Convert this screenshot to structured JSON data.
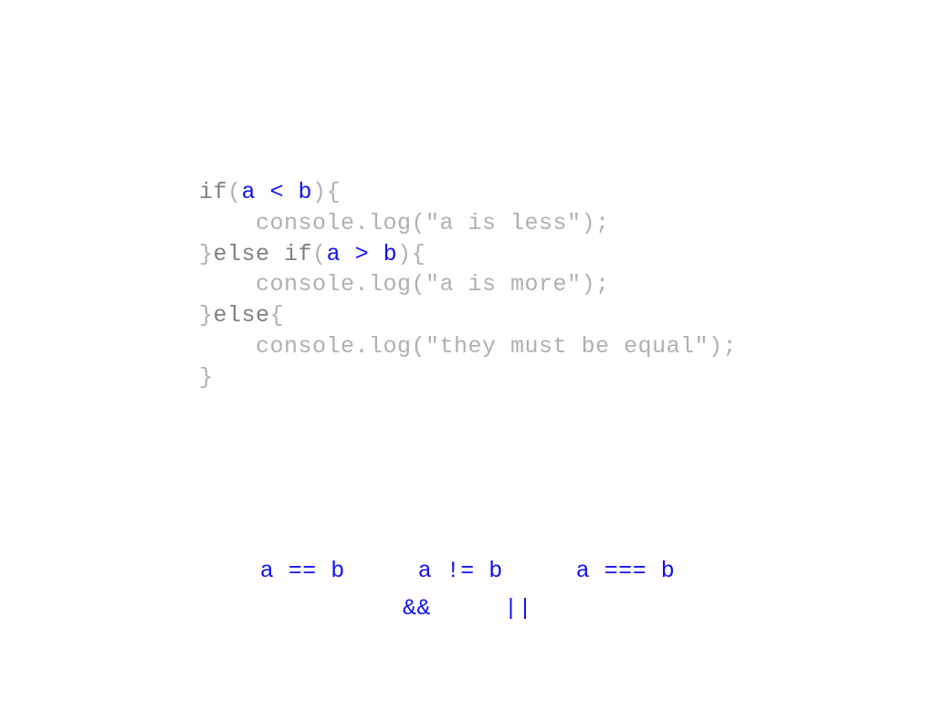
{
  "code": {
    "l1_kw": "if",
    "l1_p1": "(",
    "l1_cond": "a < b",
    "l1_p2": ")",
    "l1_brace": "{",
    "l2": "    console.log(\"a is less\");",
    "l3_brace": "}",
    "l3_kw": "else if",
    "l3_p1": "(",
    "l3_cond": "a > b",
    "l3_p2": ")",
    "l3_brace2": "{",
    "l4": "    console.log(\"a is more\");",
    "l5_brace": "}",
    "l5_kw": "else",
    "l5_brace2": "{",
    "l6": "    console.log(\"they must be equal\");",
    "l7": "}"
  },
  "ops": {
    "eq": "a == b",
    "neq": "a != b",
    "strict": "a === b",
    "and": "&&",
    "or": "||"
  }
}
